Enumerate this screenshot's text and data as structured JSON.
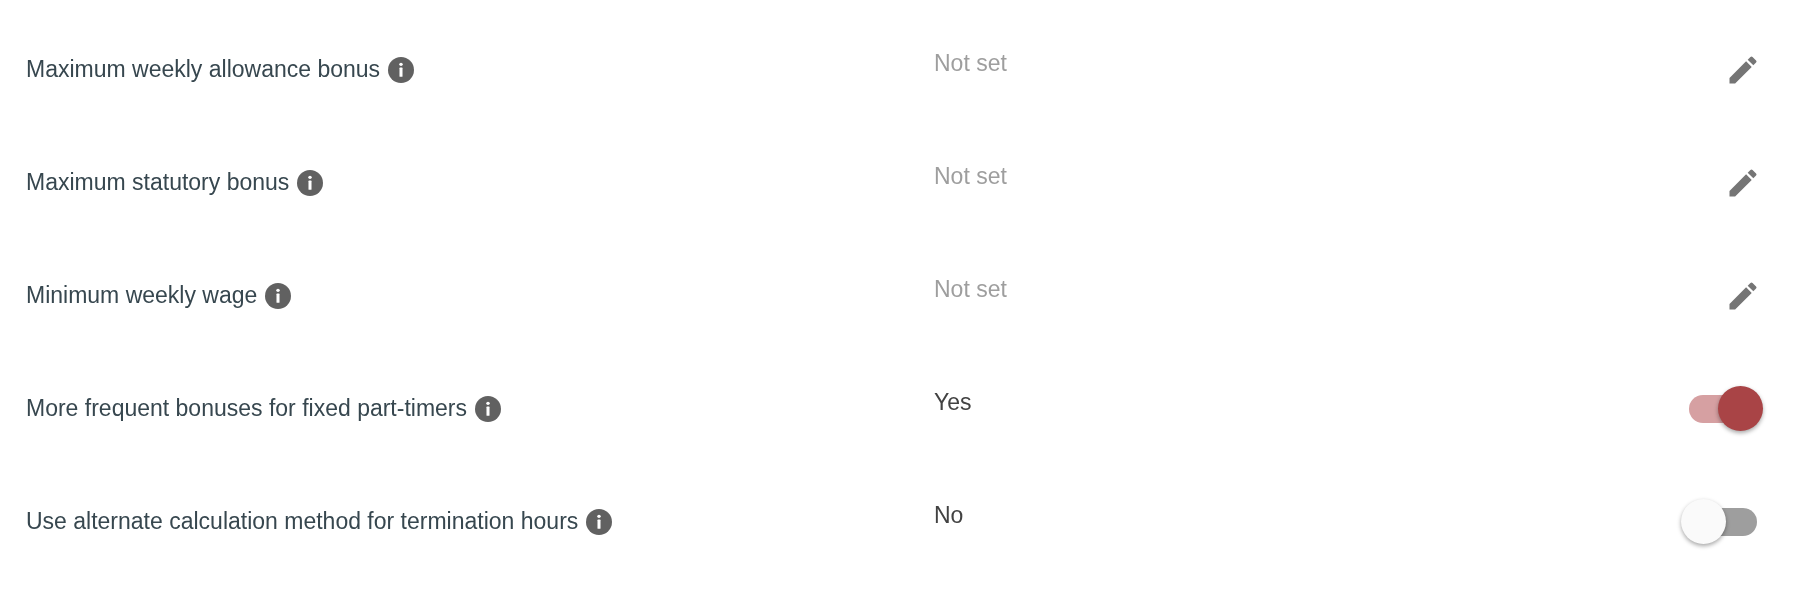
{
  "settings": [
    {
      "label": "Maximum weekly allowance bonus",
      "value": "Not set",
      "empty": true,
      "kind": "edit"
    },
    {
      "label": "Maximum statutory bonus",
      "value": "Not set",
      "empty": true,
      "kind": "edit"
    },
    {
      "label": "Minimum weekly wage",
      "value": "Not set",
      "empty": true,
      "kind": "edit"
    },
    {
      "label": "More frequent bonuses for fixed part-timers",
      "value": "Yes",
      "empty": false,
      "kind": "toggle",
      "on": true
    },
    {
      "label": "Use alternate calculation method for termination hours",
      "value": "No",
      "empty": false,
      "kind": "toggle",
      "on": false
    }
  ]
}
